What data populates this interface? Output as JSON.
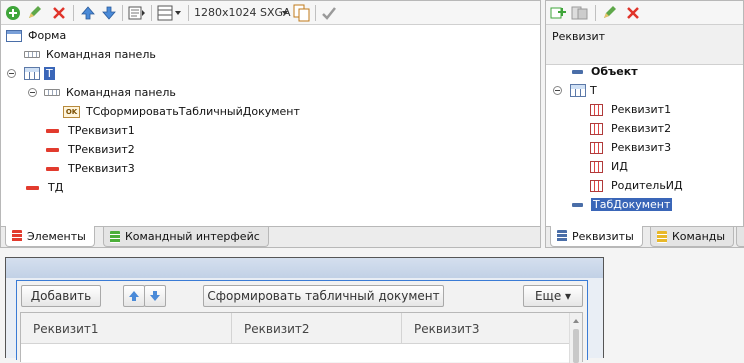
{
  "elements_panel": {
    "toolbar": {
      "resolution": "1280x1024 SXGA",
      "icons": [
        "add-icon",
        "edit-icon",
        "delete-icon",
        "move-up-icon",
        "move-down-icon",
        "preview-icon",
        "layout-icon",
        "resolution-dropdown-icon",
        "copy-icon",
        "check-icon"
      ]
    },
    "tree": {
      "form": "Форма",
      "command_panel": "Командная панель",
      "table": "Т",
      "table_command_panel": "Командная панель",
      "command_button": "ТСформироватьТабличныйДокумент",
      "attr1": "ТРеквизит1",
      "attr2": "ТРеквизит2",
      "attr3": "ТРеквизит3",
      "td": "ТД"
    },
    "tabs": {
      "elements": "Элементы",
      "command_interface": "Командный интерфейс"
    }
  },
  "attributes_panel": {
    "header": "Реквизит",
    "tree": {
      "object": "Объект",
      "table": "Т",
      "attr1": "Реквизит1",
      "attr2": "Реквизит2",
      "attr3": "Реквизит3",
      "id": "ИД",
      "parent_id": "РодительИД",
      "tab_document": "ТабДокумент"
    },
    "tabs": {
      "attributes": "Реквизиты",
      "commands": "Команды"
    }
  },
  "preview": {
    "add_button": "Добавить",
    "generate_button": "Сформировать табличный документ",
    "more_button": "Еще ▾",
    "columns": [
      "Реквизит1",
      "Реквизит2",
      "Реквизит3"
    ]
  },
  "colors": {
    "selection": "#3a66b8",
    "attribute": "#e23b2e",
    "preview_frame": "#3a7bd5"
  }
}
